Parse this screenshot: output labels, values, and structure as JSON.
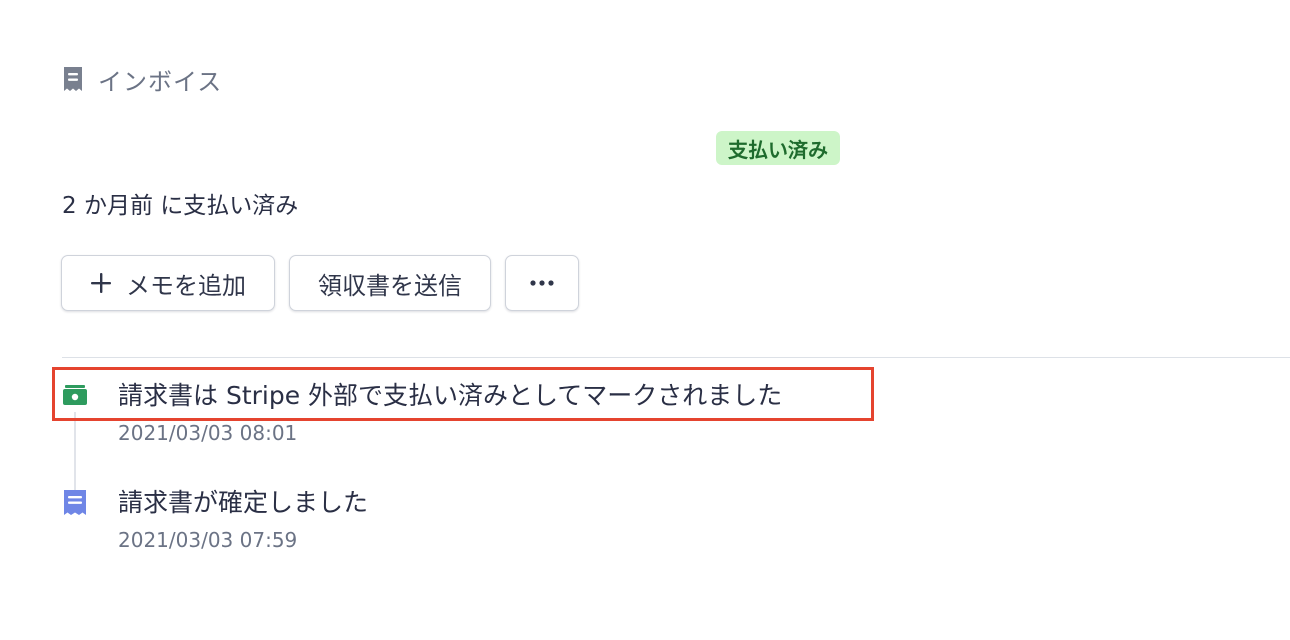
{
  "section": {
    "title": "インボイス",
    "icon": "receipt-icon"
  },
  "status": {
    "badge": "支払い済み",
    "badge_bg": "#cdf5c8",
    "badge_fg": "#1e6b2d",
    "paid_text": "2 か月前 に支払い済み"
  },
  "actions": {
    "add_memo": "メモを追加",
    "send_receipt": "領収書を送信",
    "more": "•••"
  },
  "timeline": [
    {
      "title": "請求書は Stripe 外部で支払い済みとしてマークされました",
      "time": "2021/03/03 08:01",
      "icon": "cash-icon",
      "icon_color": "#2e9b5e"
    },
    {
      "title": "請求書が確定しました",
      "time": "2021/03/03 07:59",
      "icon": "invoice-icon",
      "icon_color": "#6f86e6"
    }
  ],
  "highlight_color": "#e5442f"
}
